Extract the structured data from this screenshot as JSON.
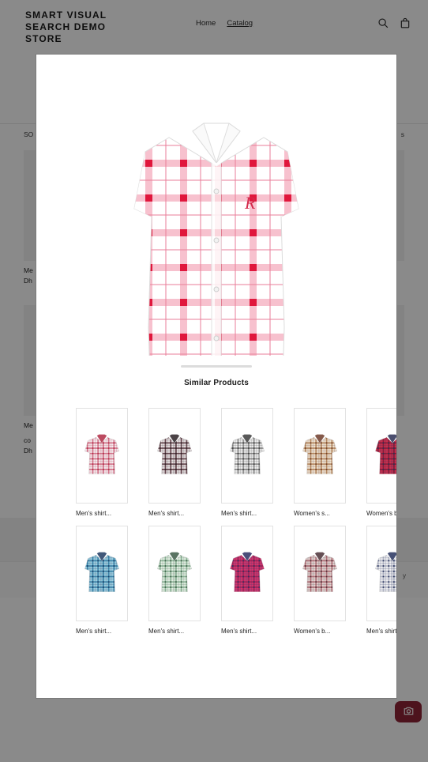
{
  "header": {
    "brand": "SMART VISUAL SEARCH DEMO STORE",
    "nav": [
      {
        "label": "Home",
        "active": false
      },
      {
        "label": "Catalog",
        "active": true
      }
    ],
    "search_icon": "search-icon",
    "cart_icon": "shopping-bag-icon"
  },
  "catalog": {
    "sort_label": "SO",
    "count_label": "s",
    "products": [
      {
        "title": "Me",
        "subtitle": "",
        "price": "Dh"
      },
      {
        "title": "Me",
        "subtitle": "co",
        "price": "Dh"
      }
    ]
  },
  "footer": {
    "text": "y"
  },
  "visual_search_button": {
    "icon": "camera-icon",
    "color": "#8f2437"
  },
  "modal": {
    "drag_handle": "drag-handle",
    "hero": {
      "alt": "Men's white shirt with pink and red checks",
      "colors": {
        "base": "#ffffff",
        "light_check": "#f4a9bd",
        "dark_check": "#e0173c"
      }
    },
    "similar_title": "Similar Products",
    "similar_products": [
      {
        "label": "Men's shirt...",
        "colors": {
          "base": "#f5eff1",
          "a": "#d4798f",
          "b": "#b02a44"
        }
      },
      {
        "label": "Men's shirt...",
        "colors": {
          "base": "#e9e3e4",
          "a": "#6b4a52",
          "b": "#2c2226"
        }
      },
      {
        "label": "Men's shirt...",
        "colors": {
          "base": "#f2f2f2",
          "a": "#8e8e8e",
          "b": "#3c3c3c"
        }
      },
      {
        "label": "Women's s...",
        "colors": {
          "base": "#efe4d4",
          "a": "#b98d63",
          "b": "#6e3c2a"
        }
      },
      {
        "label": "Women's b...",
        "colors": {
          "base": "#c9304f",
          "a": "#8b1c38",
          "b": "#2b2f55"
        }
      },
      {
        "label": "Men's shirt...",
        "colors": {
          "base": "#9fcfe0",
          "a": "#3d89ad",
          "b": "#1e3b63"
        }
      },
      {
        "label": "Men's shirt...",
        "colors": {
          "base": "#e3efe3",
          "a": "#8fb79a",
          "b": "#3c5a46"
        }
      },
      {
        "label": "Men's shirt...",
        "colors": {
          "base": "#d2376f",
          "a": "#a32356",
          "b": "#2b2f63"
        }
      },
      {
        "label": "Women's b...",
        "colors": {
          "base": "#e2d4d2",
          "a": "#b4727a",
          "b": "#4a3036"
        }
      },
      {
        "label": "Men's shirt...",
        "colors": {
          "base": "#f0f0f2",
          "a": "#b9bcc8",
          "b": "#27325e"
        }
      }
    ]
  }
}
